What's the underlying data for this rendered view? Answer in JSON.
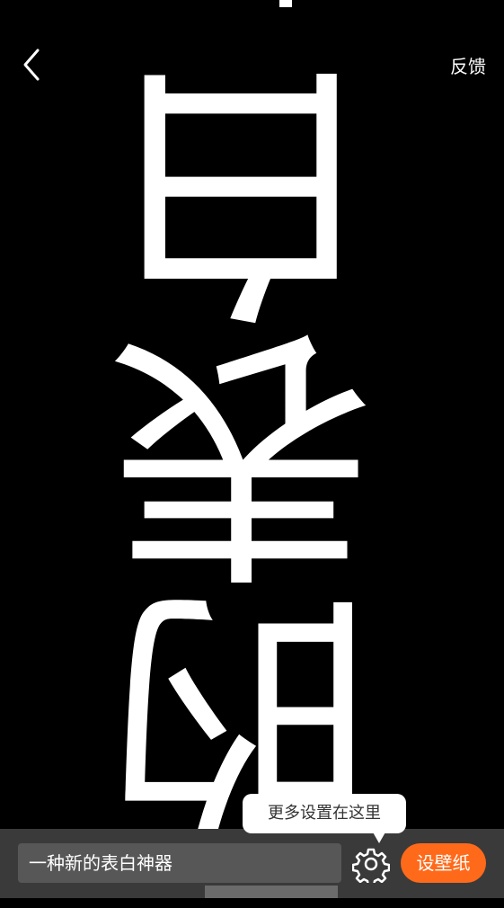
{
  "header": {
    "back_icon": "chevron-left-icon",
    "feedback_label": "反馈"
  },
  "preview": {
    "text": "的表白"
  },
  "tooltip": {
    "text": "更多设置在这里"
  },
  "bottom_bar": {
    "input_value": "一种新的表白神器",
    "settings_icon": "gear-icon",
    "set_wallpaper_label": "设壁纸"
  },
  "colors": {
    "background": "#000000",
    "accent": "#ff6a1a",
    "bar": "#3a3a3a"
  }
}
